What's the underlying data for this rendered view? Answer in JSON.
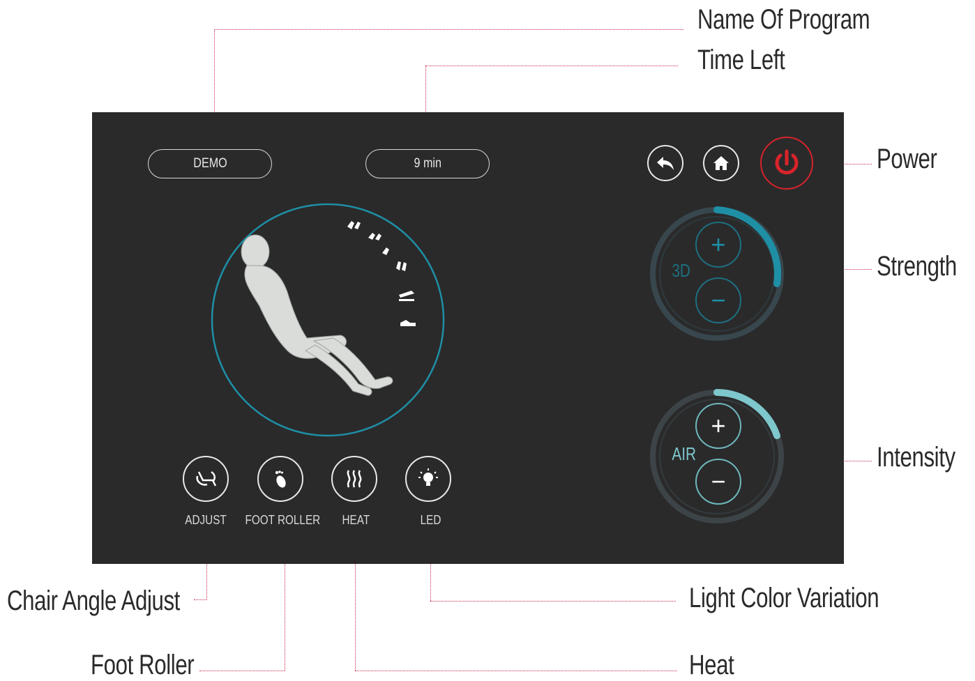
{
  "callouts": {
    "name_of_program": "Name Of Program",
    "time_left": "Time Left",
    "power": "Power",
    "strength": "Strength",
    "intensity": "Intensity",
    "chair_angle_adjust": "Chair Angle Adjust",
    "foot_roller": "Foot Roller",
    "light_color_variation": "Light Color Variation",
    "heat": "Heat"
  },
  "header": {
    "program_name": "DEMO",
    "time_left": "9 min"
  },
  "nav": {
    "back_icon": "back-arrow-icon",
    "home_icon": "home-icon",
    "power_icon": "power-icon"
  },
  "strength_dial": {
    "label": "3D",
    "plus": "+",
    "minus": "−",
    "level": 0.45
  },
  "intensity_dial": {
    "label": "AIR",
    "plus": "+",
    "minus": "−",
    "level": 0.2
  },
  "controls": [
    {
      "label": "ADJUST",
      "icon": "chair-adjust-icon"
    },
    {
      "label": "FOOT ROLLER",
      "icon": "foot-icon"
    },
    {
      "label": "HEAT",
      "icon": "heat-waves-icon"
    },
    {
      "label": "LED",
      "icon": "lightbulb-icon"
    }
  ],
  "colors": {
    "screen_bg": "#2a2a2b",
    "accent_teal": "#1e8fa5",
    "accent_air": "#7ec7cc",
    "power_red": "#d8232a",
    "leader_red": "#c8284c"
  }
}
